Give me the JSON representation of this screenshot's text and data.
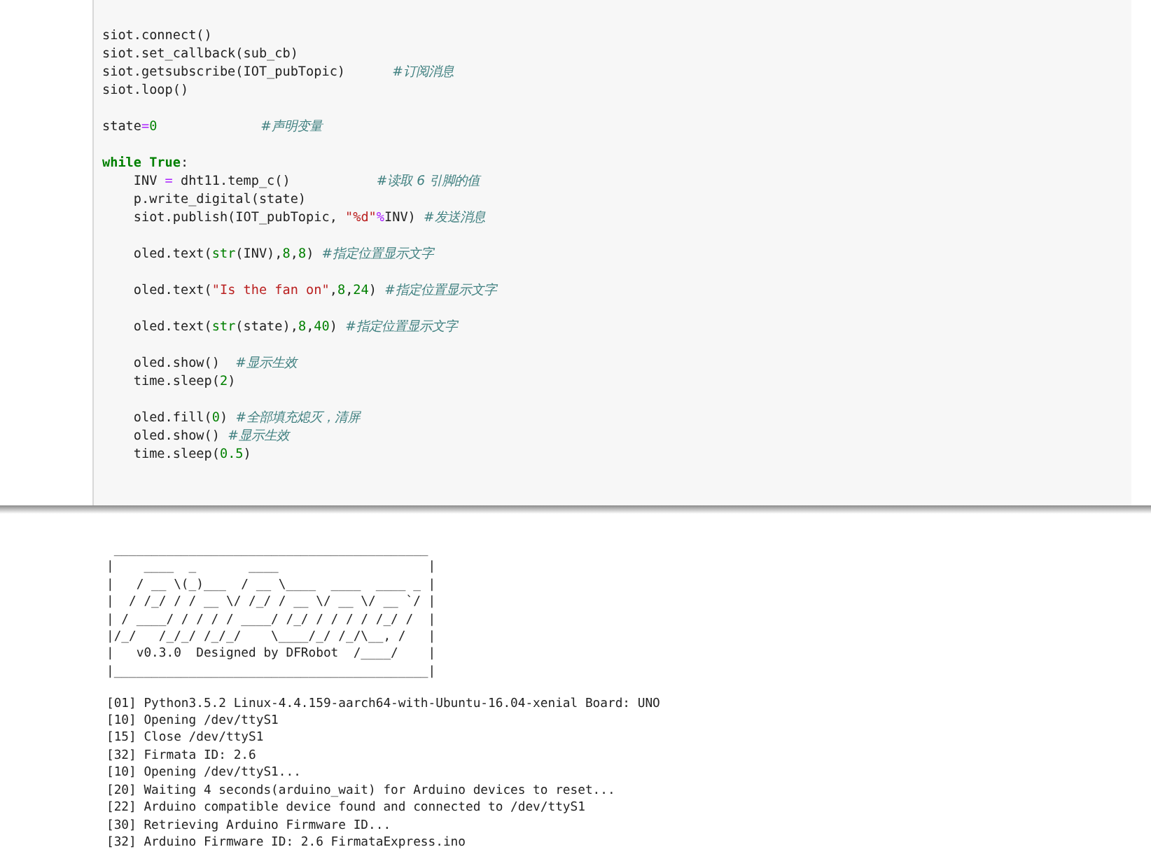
{
  "code_cell": {
    "lines": [
      {
        "kind": "code",
        "tokens": [
          {
            "kind": "plain",
            "text": "siot.connect()"
          }
        ]
      },
      {
        "kind": "code",
        "tokens": [
          {
            "kind": "plain",
            "text": "siot.set_callback(sub_cb)"
          }
        ]
      },
      {
        "kind": "code",
        "tokens": [
          {
            "kind": "plain",
            "text": "siot.getsubscribe(IOT_pubTopic)      "
          },
          {
            "kind": "comment",
            "text": "#订阅消息"
          }
        ]
      },
      {
        "kind": "code",
        "tokens": [
          {
            "kind": "plain",
            "text": "siot.loop()"
          }
        ]
      },
      {
        "kind": "blank"
      },
      {
        "kind": "code",
        "tokens": [
          {
            "kind": "plain",
            "text": "state"
          },
          {
            "kind": "op",
            "text": "="
          },
          {
            "kind": "num",
            "text": "0"
          },
          {
            "kind": "comment",
            "text": "                         #声明变量"
          }
        ]
      },
      {
        "kind": "blank"
      },
      {
        "kind": "code",
        "tokens": [
          {
            "kind": "kw",
            "text": "while True"
          },
          {
            "kind": "plain",
            "text": ":"
          }
        ]
      },
      {
        "kind": "code",
        "tokens": [
          {
            "kind": "plain",
            "text": "    INV "
          },
          {
            "kind": "op",
            "text": "="
          },
          {
            "kind": "plain",
            "text": " dht11.temp_c()           "
          },
          {
            "kind": "comment",
            "text": "#读取 6 引脚的值"
          }
        ]
      },
      {
        "kind": "code",
        "tokens": [
          {
            "kind": "plain",
            "text": "    p.write_digital(state)"
          }
        ]
      },
      {
        "kind": "code",
        "tokens": [
          {
            "kind": "plain",
            "text": "    siot.publish(IOT_pubTopic, "
          },
          {
            "kind": "str",
            "text": "\"%d\""
          },
          {
            "kind": "op",
            "text": "%"
          },
          {
            "kind": "plain",
            "text": "INV) "
          },
          {
            "kind": "comment",
            "text": "#发送消息"
          }
        ]
      },
      {
        "kind": "blank"
      },
      {
        "kind": "code",
        "tokens": [
          {
            "kind": "plain",
            "text": "    oled.text("
          },
          {
            "kind": "builtin",
            "text": "str"
          },
          {
            "kind": "plain",
            "text": "(INV),"
          },
          {
            "kind": "num",
            "text": "8"
          },
          {
            "kind": "plain",
            "text": ","
          },
          {
            "kind": "num",
            "text": "8"
          },
          {
            "kind": "plain",
            "text": ") "
          },
          {
            "kind": "comment",
            "text": "#指定位置显示文字"
          }
        ]
      },
      {
        "kind": "blank"
      },
      {
        "kind": "code",
        "tokens": [
          {
            "kind": "plain",
            "text": "    oled.text("
          },
          {
            "kind": "str",
            "text": "\"Is the fan on\""
          },
          {
            "kind": "plain",
            "text": ","
          },
          {
            "kind": "num",
            "text": "8"
          },
          {
            "kind": "plain",
            "text": ","
          },
          {
            "kind": "num",
            "text": "24"
          },
          {
            "kind": "plain",
            "text": ") "
          },
          {
            "kind": "comment",
            "text": "#指定位置显示文字"
          }
        ]
      },
      {
        "kind": "blank"
      },
      {
        "kind": "code",
        "tokens": [
          {
            "kind": "plain",
            "text": "    oled.text("
          },
          {
            "kind": "builtin",
            "text": "str"
          },
          {
            "kind": "plain",
            "text": "(state),"
          },
          {
            "kind": "num",
            "text": "8"
          },
          {
            "kind": "plain",
            "text": ","
          },
          {
            "kind": "num",
            "text": "40"
          },
          {
            "kind": "plain",
            "text": ") "
          },
          {
            "kind": "comment",
            "text": "#指定位置显示文字"
          }
        ]
      },
      {
        "kind": "blank"
      },
      {
        "kind": "code",
        "tokens": [
          {
            "kind": "plain",
            "text": "    oled.show()  "
          },
          {
            "kind": "comment",
            "text": "#显示生效"
          }
        ]
      },
      {
        "kind": "code",
        "tokens": [
          {
            "kind": "plain",
            "text": "    time.sleep("
          },
          {
            "kind": "num",
            "text": "2"
          },
          {
            "kind": "plain",
            "text": ")"
          }
        ]
      },
      {
        "kind": "blank"
      },
      {
        "kind": "code",
        "tokens": [
          {
            "kind": "plain",
            "text": "    oled.fill("
          },
          {
            "kind": "num",
            "text": "0"
          },
          {
            "kind": "plain",
            "text": ") "
          },
          {
            "kind": "comment",
            "text": "#全部填充熄灭，清屏"
          }
        ]
      },
      {
        "kind": "code",
        "tokens": [
          {
            "kind": "plain",
            "text": "    oled.show() "
          },
          {
            "kind": "comment",
            "text": "#显示生效"
          }
        ]
      },
      {
        "kind": "code",
        "tokens": [
          {
            "kind": "plain",
            "text": "    time.sleep("
          },
          {
            "kind": "num",
            "text": "0.5"
          },
          {
            "kind": "plain",
            "text": ")"
          }
        ]
      }
    ]
  },
  "output": {
    "banner": " __________________________________________\n|    ____  _       ____                    |\n|   / __ \\(_)___  / __ \\____  ____  ____ _ |\n|  / /_/ / / __ \\/ /_/ / __ \\/ __ \\/ __ `/ |\n| / ____/ / / / / ____/ /_/ / / / / /_/ /  |\n|/_/   /_/_/ /_/_/    \\____/_/ /_/\\__, /   |\n|   v0.3.0  Designed by DFRobot  /____/    |\n|__________________________________________|",
    "log": [
      "[01] Python3.5.2 Linux-4.4.159-aarch64-with-Ubuntu-16.04-xenial Board: UNO",
      "[10] Opening /dev/ttyS1",
      "[15] Close /dev/ttyS1",
      "[32] Firmata ID: 2.6",
      "[10] Opening /dev/ttyS1...",
      "[20] Waiting 4 seconds(arduino_wait) for Arduino devices to reset...",
      "[22] Arduino compatible device found and connected to /dev/ttyS1",
      "[30] Retrieving Arduino Firmware ID...",
      "[32] Arduino Firmware ID: 2.6 FirmataExpress.ino"
    ]
  }
}
